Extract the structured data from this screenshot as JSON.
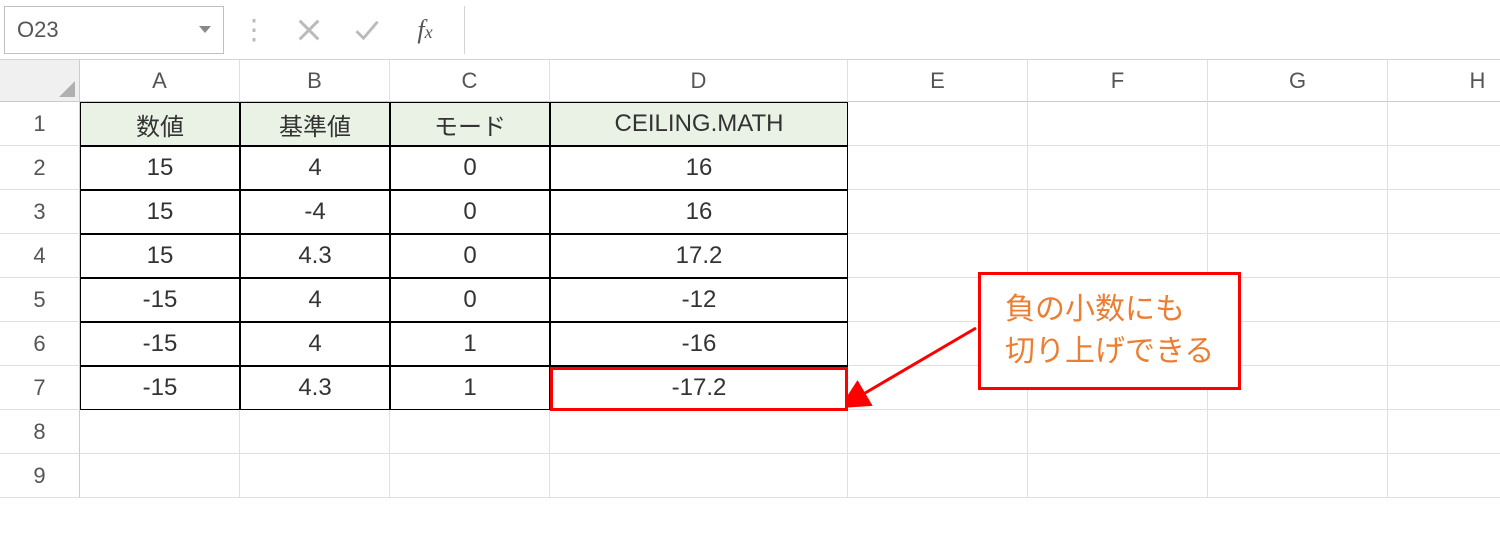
{
  "nameBox": {
    "value": "O23"
  },
  "formulaBar": {
    "value": ""
  },
  "columns": [
    "A",
    "B",
    "C",
    "D",
    "E",
    "F",
    "G",
    "H"
  ],
  "rowNumbers": [
    "1",
    "2",
    "3",
    "4",
    "5",
    "6",
    "7",
    "8",
    "9"
  ],
  "table": {
    "headers": {
      "A": "数値",
      "B": "基準値",
      "C": "モード",
      "D": "CEILING.MATH"
    },
    "rows": [
      {
        "A": "15",
        "B": "4",
        "C": "0",
        "D": "16"
      },
      {
        "A": "15",
        "B": "-4",
        "C": "0",
        "D": "16"
      },
      {
        "A": "15",
        "B": "4.3",
        "C": "0",
        "D": "17.2"
      },
      {
        "A": "-15",
        "B": "4",
        "C": "0",
        "D": "-12"
      },
      {
        "A": "-15",
        "B": "4",
        "C": "1",
        "D": "-16"
      },
      {
        "A": "-15",
        "B": "4.3",
        "C": "1",
        "D": "-17.2"
      }
    ]
  },
  "annotation": {
    "line1": "負の小数にも",
    "line2": "切り上げできる"
  },
  "chart_data": {
    "type": "table",
    "title": "CEILING.MATH",
    "columns": [
      "数値",
      "基準値",
      "モード",
      "CEILING.MATH"
    ],
    "rows": [
      [
        15,
        4,
        0,
        16
      ],
      [
        15,
        -4,
        0,
        16
      ],
      [
        15,
        4.3,
        0,
        17.2
      ],
      [
        -15,
        4,
        0,
        -12
      ],
      [
        -15,
        4,
        1,
        -16
      ],
      [
        -15,
        4.3,
        1,
        -17.2
      ]
    ]
  }
}
